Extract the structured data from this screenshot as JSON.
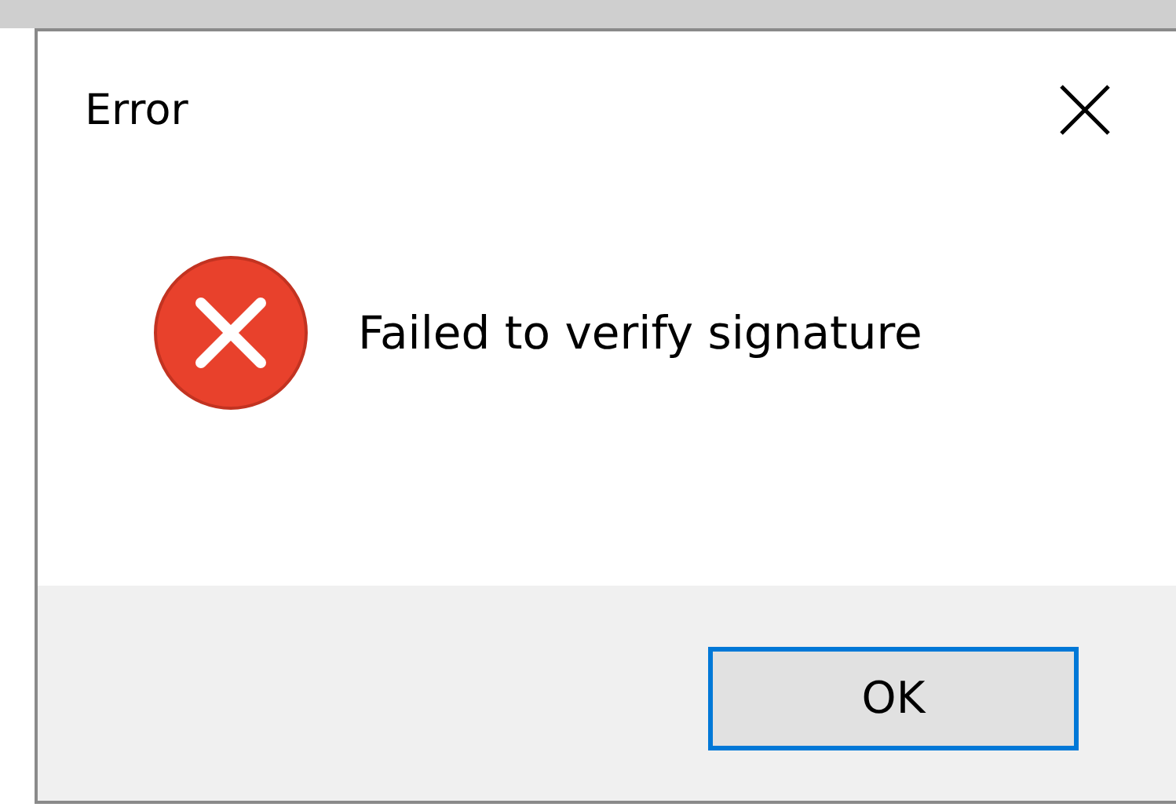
{
  "window": {
    "title": "Error"
  },
  "message": {
    "kind": "error",
    "text": "Failed to verify signature"
  },
  "buttons": [
    {
      "label": "OK",
      "default": true
    }
  ]
}
